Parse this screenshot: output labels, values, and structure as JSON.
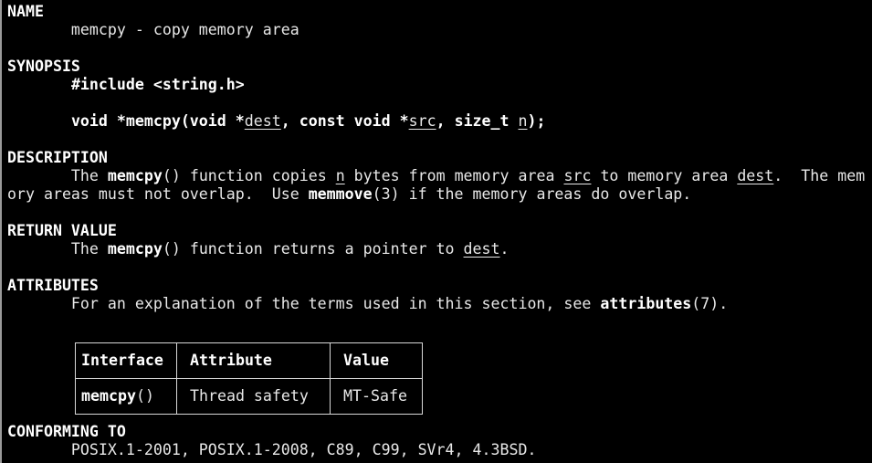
{
  "lines": [
    {
      "row": 0,
      "segs": [
        {
          "t": "NAME",
          "s": "b"
        }
      ]
    },
    {
      "row": 1,
      "segs": [
        {
          "t": "       memcpy - copy memory area",
          "s": ""
        }
      ]
    },
    {
      "row": 3,
      "segs": [
        {
          "t": "SYNOPSIS",
          "s": "b"
        }
      ]
    },
    {
      "row": 4,
      "segs": [
        {
          "t": "       ",
          "s": ""
        },
        {
          "t": "#include <string.h>",
          "s": "b"
        }
      ]
    },
    {
      "row": 6,
      "segs": [
        {
          "t": "       ",
          "s": ""
        },
        {
          "t": "void *memcpy(void *",
          "s": "b"
        },
        {
          "t": "dest",
          "s": "u"
        },
        {
          "t": ", const void *",
          "s": "b"
        },
        {
          "t": "src",
          "s": "u"
        },
        {
          "t": ", size_t ",
          "s": "b"
        },
        {
          "t": "n",
          "s": "u"
        },
        {
          "t": ");",
          "s": "b"
        }
      ]
    },
    {
      "row": 8,
      "segs": [
        {
          "t": "DESCRIPTION",
          "s": "b"
        }
      ]
    },
    {
      "row": 9,
      "segs": [
        {
          "t": "       The ",
          "s": ""
        },
        {
          "t": "memcpy",
          "s": "b"
        },
        {
          "t": "() function copies ",
          "s": ""
        },
        {
          "t": "n",
          "s": "u"
        },
        {
          "t": " bytes from memory area ",
          "s": ""
        },
        {
          "t": "src",
          "s": "u"
        },
        {
          "t": " to memory area ",
          "s": ""
        },
        {
          "t": "dest",
          "s": "u"
        },
        {
          "t": ".  The mem",
          "s": ""
        }
      ]
    },
    {
      "row": 10,
      "segs": [
        {
          "t": "ory areas must not overlap.  Use ",
          "s": ""
        },
        {
          "t": "memmove",
          "s": "b"
        },
        {
          "t": "(3) if the memory areas do overlap.",
          "s": ""
        }
      ]
    },
    {
      "row": 12,
      "segs": [
        {
          "t": "RETURN VALUE",
          "s": "b"
        }
      ]
    },
    {
      "row": 13,
      "segs": [
        {
          "t": "       The ",
          "s": ""
        },
        {
          "t": "memcpy",
          "s": "b"
        },
        {
          "t": "() function returns a pointer to ",
          "s": ""
        },
        {
          "t": "dest",
          "s": "u"
        },
        {
          "t": ".",
          "s": ""
        }
      ]
    },
    {
      "row": 15,
      "segs": [
        {
          "t": "ATTRIBUTES",
          "s": "b"
        }
      ]
    },
    {
      "row": 16,
      "segs": [
        {
          "t": "       For an explanation of the terms used in this section, see ",
          "s": ""
        },
        {
          "t": "attributes",
          "s": "b"
        },
        {
          "t": "(7).",
          "s": ""
        }
      ]
    },
    {
      "row": 23,
      "segs": [
        {
          "t": "CONFORMING TO",
          "s": "b"
        }
      ]
    },
    {
      "row": 24,
      "segs": [
        {
          "t": "       POSIX.1-2001, POSIX.1-2008, C89, C99, SVr4, 4.3BSD.",
          "s": ""
        }
      ]
    }
  ],
  "table": {
    "headers": [
      "Interface",
      "Attribute",
      "Value"
    ],
    "row": {
      "func": "memcpy",
      "parens": "()",
      "attribute": "Thread safety",
      "value": "MT-Safe"
    }
  }
}
